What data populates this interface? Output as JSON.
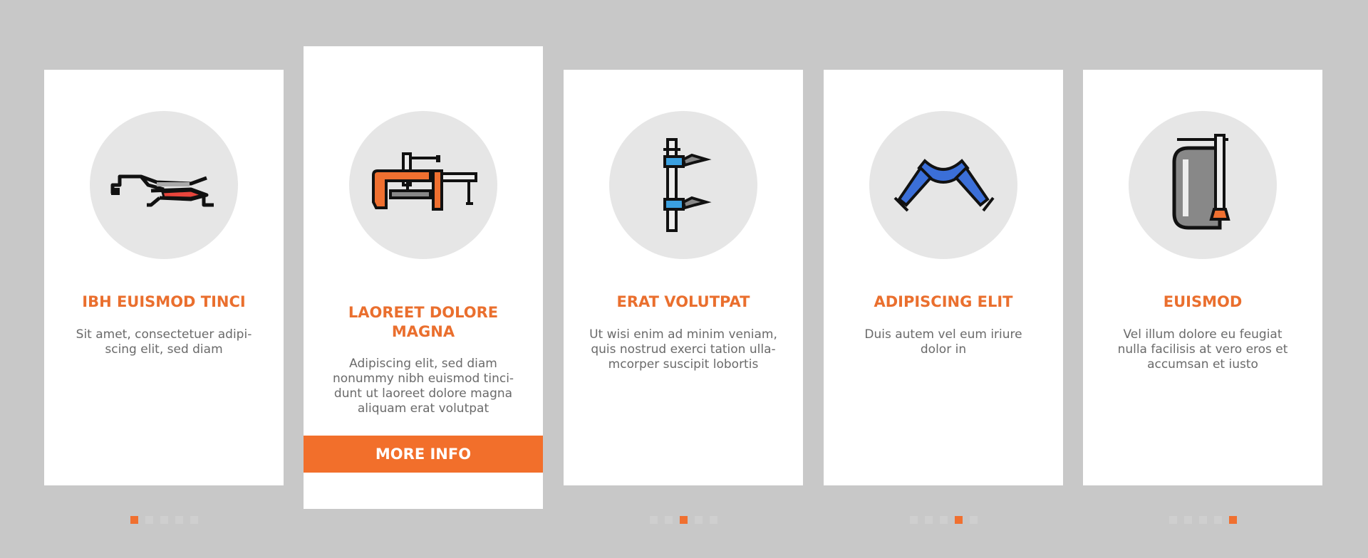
{
  "colors": {
    "background": "#c8c8c8",
    "accent": "#f07030",
    "title": "#ea6f2e",
    "text": "#6a6a6a",
    "dot_inactive": "#cfcfcf"
  },
  "cards": [
    {
      "icon": "pliers-clamp-icon",
      "title": "IBH EUISMOD TINCI",
      "text": "Sit amet, consectetuer adipi-\nscing elit, sed diam",
      "active_dot": 0
    },
    {
      "icon": "bar-clamp-icon",
      "title": "LAOREET DOLORE\nMAGNA",
      "text": "Adipiscing elit, sed diam\nnonummy nibh euismod tinci-\ndunt ut laoreet dolore magna\naliquam erat volutpat",
      "button": "MORE INFO"
    },
    {
      "icon": "f-clamp-icon",
      "title": "ERAT VOLUTPAT",
      "text": "Ut wisi enim ad minim veniam,\nquis nostrud exerci tation ulla-\nmcorper suscipit lobortis",
      "active_dot": 2
    },
    {
      "icon": "corner-clamp-icon",
      "title": "ADIPISCING ELIT",
      "text": "Duis autem vel eum iriure\ndolor in",
      "active_dot": 3
    },
    {
      "icon": "c-clamp-icon",
      "title": "EUISMOD",
      "text": "Vel illum dolore eu feugiat\nnulla facilisis at vero eros et\naccumsan et iusto",
      "active_dot": 4
    }
  ]
}
